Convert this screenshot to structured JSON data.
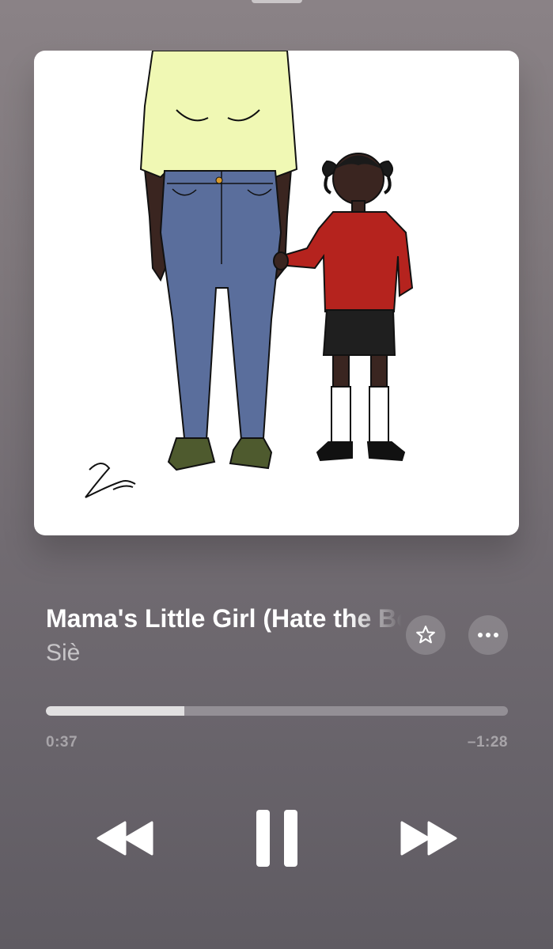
{
  "track": {
    "title": "Mama's Little Girl (Hate the Boys)",
    "artist": "Siè"
  },
  "playback": {
    "elapsed": "0:37",
    "remaining": "–1:28",
    "progress_fraction": 0.3
  },
  "icons": {
    "favorite": "star-icon",
    "more": "ellipsis-icon",
    "rewind": "rewind-icon",
    "pause": "pause-icon",
    "forward": "fast-forward-icon"
  },
  "colors": {
    "shirt": "#f0f8b4",
    "jeans": "#5a6e9c",
    "sweater": "#b5231e",
    "skirt": "#1f1f1f",
    "skin": "#3a2520",
    "shoes_adult": "#4e5a2e"
  }
}
